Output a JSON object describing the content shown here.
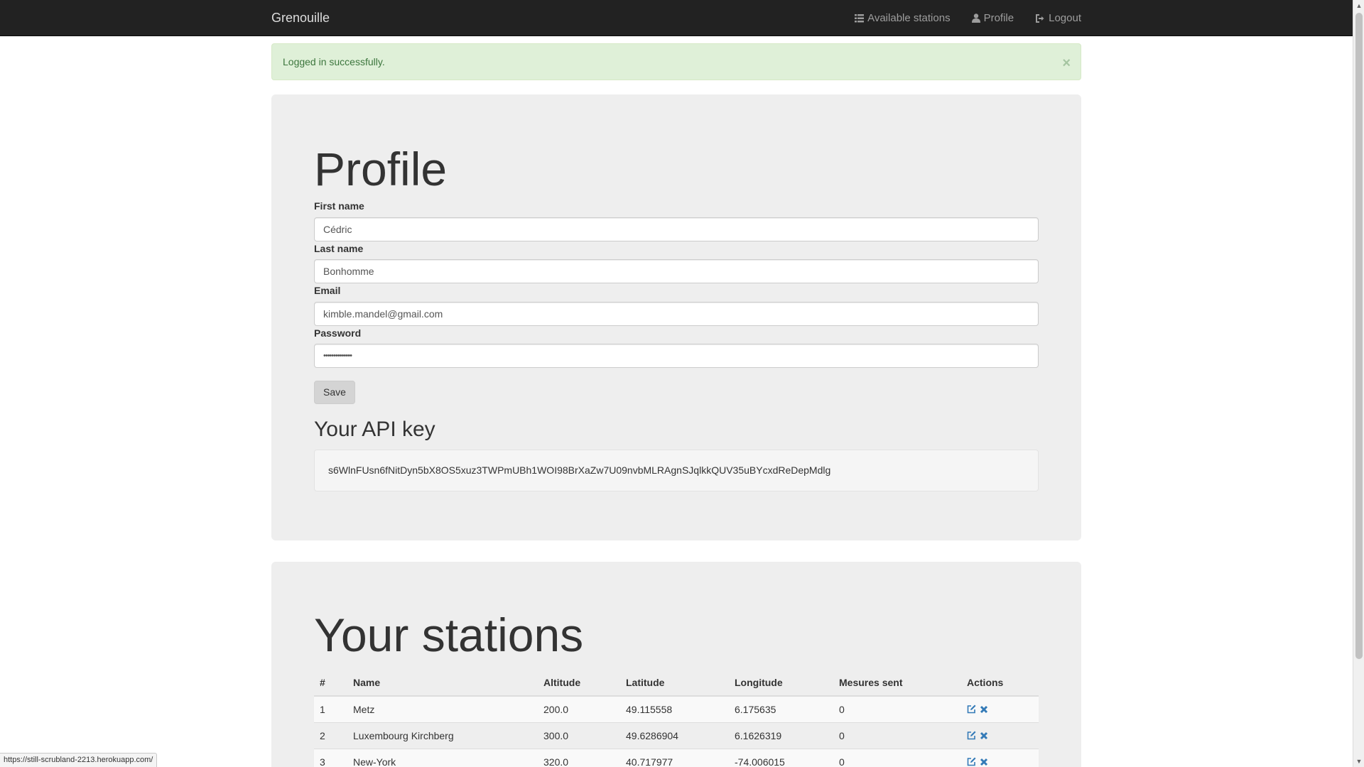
{
  "navbar": {
    "brand": "Grenouille",
    "links": [
      {
        "label": "Available stations",
        "icon": "list-icon"
      },
      {
        "label": "Profile",
        "icon": "user-icon"
      },
      {
        "label": "Logout",
        "icon": "logout-icon"
      }
    ]
  },
  "alert": {
    "message": "Logged in successfully.",
    "close": "×"
  },
  "profile": {
    "title": "Profile",
    "fields": {
      "first_name": {
        "label": "First name",
        "value": "Cédric"
      },
      "last_name": {
        "label": "Last name",
        "value": "Bonhomme"
      },
      "email": {
        "label": "Email",
        "value": "kimble.mandel@gmail.com"
      },
      "password": {
        "label": "Password",
        "value": "••••••••••••••"
      }
    },
    "save_label": "Save",
    "api_title": "Your API key",
    "api_key": "s6WlnFUsn6fNitDyn5bX8OS5xuz3TWPmUBh1WOI98BrXaZw7U09nvbMLRAgnSJqlkkQUV35uBYcxdReDepMdlg"
  },
  "stations": {
    "title": "Your stations",
    "columns": [
      "#",
      "Name",
      "Altitude",
      "Latitude",
      "Longitude",
      "Mesures sent",
      "Actions"
    ],
    "rows": [
      {
        "id": "1",
        "name": "Metz",
        "altitude": "200.0",
        "latitude": "49.115558",
        "longitude": "6.175635",
        "mesures": "0"
      },
      {
        "id": "2",
        "name": "Luxembourg Kirchberg",
        "altitude": "300.0",
        "latitude": "49.6286904",
        "longitude": "6.1626319",
        "mesures": "0"
      },
      {
        "id": "3",
        "name": "New-York",
        "altitude": "320.0",
        "latitude": "40.717977",
        "longitude": "-74.006015",
        "mesures": "0"
      }
    ]
  },
  "statusbar": {
    "url": "https://still-scrubland-2213.herokuapp.com/"
  },
  "colors": {
    "navbar_bg": "#222222",
    "alert_bg": "#dff0d8",
    "alert_text": "#3c763d",
    "jumbotron_bg": "#eeeeee",
    "action_icon": "#337ab7"
  }
}
